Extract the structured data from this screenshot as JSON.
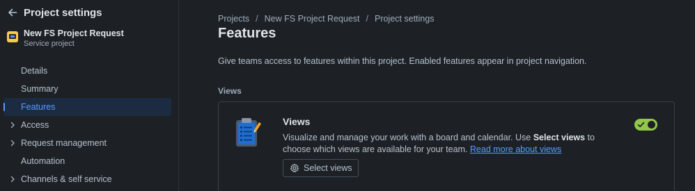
{
  "sidebar": {
    "title": "Project settings",
    "project": {
      "name": "New FS Project Request",
      "type": "Service project"
    },
    "items": [
      {
        "label": "Details",
        "expandable": false,
        "active": false
      },
      {
        "label": "Summary",
        "expandable": false,
        "active": false
      },
      {
        "label": "Features",
        "expandable": false,
        "active": true
      },
      {
        "label": "Access",
        "expandable": true,
        "active": false
      },
      {
        "label": "Request management",
        "expandable": true,
        "active": false
      },
      {
        "label": "Automation",
        "expandable": false,
        "active": false
      },
      {
        "label": "Channels & self service",
        "expandable": true,
        "active": false
      }
    ]
  },
  "breadcrumb": [
    "Projects",
    "New FS Project Request",
    "Project settings"
  ],
  "page": {
    "title": "Features",
    "intro": "Give teams access to features within this project. Enabled features appear in project navigation."
  },
  "section": {
    "label": "Views"
  },
  "card": {
    "title": "Views",
    "desc_part1": "Visualize and manage your work with a board and calendar. Use ",
    "desc_bold": "Select views",
    "desc_part2": " to choose which views are available for your team. ",
    "link": "Read more about views",
    "button": "Select views",
    "enabled": true
  },
  "colors": {
    "accent": "#579dff",
    "toggle_on": "#94c748",
    "avatar": "#f5cd47"
  },
  "icons": [
    "back-arrow-icon",
    "project-avatar-icon",
    "chevron-right-icon",
    "clipboard-icon",
    "gear-icon",
    "check-icon"
  ]
}
